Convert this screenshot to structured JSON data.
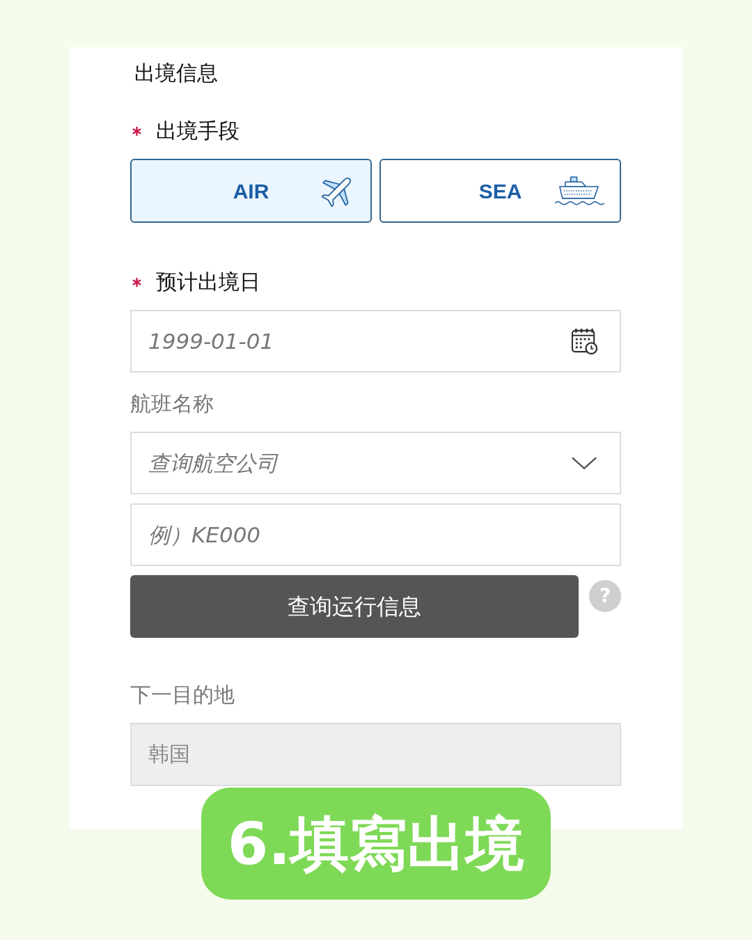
{
  "section_title": "出境信息",
  "fields": [
    {
      "kind": "choice",
      "label": "出境手段",
      "required": true,
      "options": [
        {
          "kind": "air",
          "label": "AIR",
          "selected": true
        },
        {
          "kind": "sea",
          "label": "SEA",
          "selected": false
        }
      ]
    },
    {
      "kind": "date",
      "label": "预计出境日",
      "required": true,
      "placeholder": "1999-01-01"
    },
    {
      "kind": "flight",
      "label": "航班名称",
      "required": false,
      "airline": {
        "placeholder": "查询航空公司"
      },
      "flight_number": {
        "placeholder": "例）KE000"
      },
      "lookup_button": "查询运行信息",
      "help_button": "?"
    },
    {
      "kind": "readonly",
      "label": "下一目的地",
      "required": false,
      "value": "韩国",
      "disabled": true
    }
  ],
  "step_badge": "6.填寫出境"
}
